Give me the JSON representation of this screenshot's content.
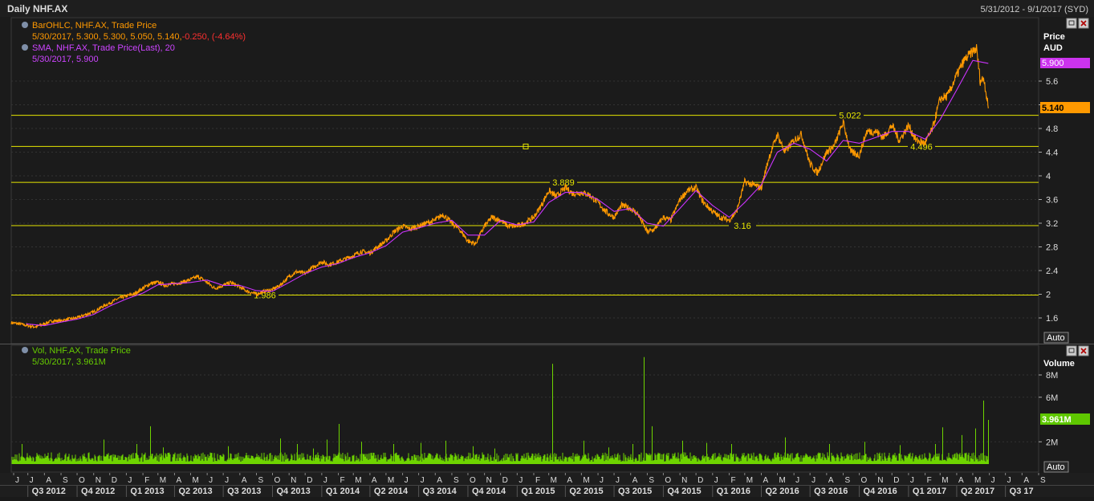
{
  "header": {
    "title": "Daily NHF.AX",
    "range": "5/31/2012 - 9/1/2017 (SYD)"
  },
  "price_panel": {
    "legend": [
      {
        "name": "BarOHLC, NHF.AX, Trade Price",
        "values": "5/30/2017, 5.300, 5.300, 5.050, 5.140,",
        "change": "-0.250, (-4.64%)",
        "color": "#ff9900",
        "change_color": "#ff3030"
      },
      {
        "name": "SMA, NHF.AX, Trade Price(Last),  20",
        "values": "5/30/2017, 5.900",
        "color": "#cc44ff"
      }
    ],
    "axis_title_1": "Price",
    "axis_title_2": "AUD",
    "auto_label": "Auto",
    "badges": {
      "sma": "5.900",
      "last": "5.140"
    }
  },
  "volume_panel": {
    "legend": {
      "name": "Vol, NHF.AX, Trade Price",
      "values": "5/30/2017, 3.961M",
      "color": "#66cc00"
    },
    "axis_title": "Volume",
    "auto_label": "Auto",
    "badge": "3.961M"
  },
  "colors": {
    "price": "#ff9900",
    "sma": "#cc33ff",
    "volume": "#6ed400",
    "hline": "#e6e600",
    "bg": "#1b1b1b",
    "grid": "#333333"
  },
  "chart_data": [
    {
      "type": "line",
      "title": "Daily NHF.AX",
      "x_range": [
        "2012-05-31",
        "2017-09-01"
      ],
      "ylabel": "Price AUD",
      "ylim": [
        1.2,
        6.3
      ],
      "yticks": [
        "1.6",
        "2",
        "2.4",
        "2.8",
        "3.2",
        "3.6",
        "4",
        "4.4",
        "4.8",
        "5.2",
        "5.6"
      ],
      "grid": true,
      "series": [
        {
          "name": "BarOHLC, NHF.AX, Trade Price",
          "points": [
            [
              "2012-05-31",
              1.52
            ],
            [
              "2012-06-15",
              1.5
            ],
            [
              "2012-07-01",
              1.47
            ],
            [
              "2012-07-15",
              1.45
            ],
            [
              "2012-08-01",
              1.5
            ],
            [
              "2012-08-15",
              1.55
            ],
            [
              "2012-09-01",
              1.55
            ],
            [
              "2012-09-15",
              1.58
            ],
            [
              "2012-10-01",
              1.6
            ],
            [
              "2012-10-15",
              1.65
            ],
            [
              "2012-11-01",
              1.7
            ],
            [
              "2012-11-15",
              1.78
            ],
            [
              "2012-12-01",
              1.85
            ],
            [
              "2012-12-15",
              1.92
            ],
            [
              "2013-01-01",
              1.97
            ],
            [
              "2013-01-15",
              2.0
            ],
            [
              "2013-02-01",
              2.1
            ],
            [
              "2013-02-15",
              2.18
            ],
            [
              "2013-03-01",
              2.2
            ],
            [
              "2013-03-15",
              2.15
            ],
            [
              "2013-04-01",
              2.18
            ],
            [
              "2013-04-15",
              2.2
            ],
            [
              "2013-05-01",
              2.25
            ],
            [
              "2013-05-15",
              2.3
            ],
            [
              "2013-06-01",
              2.2
            ],
            [
              "2013-06-15",
              2.1
            ],
            [
              "2013-07-01",
              2.15
            ],
            [
              "2013-07-15",
              2.2
            ],
            [
              "2013-08-01",
              2.12
            ],
            [
              "2013-08-15",
              2.05
            ],
            [
              "2013-09-01",
              2.0
            ],
            [
              "2013-09-15",
              2.05
            ],
            [
              "2013-10-01",
              2.08
            ],
            [
              "2013-10-15",
              2.15
            ],
            [
              "2013-11-01",
              2.3
            ],
            [
              "2013-11-15",
              2.38
            ],
            [
              "2013-12-01",
              2.35
            ],
            [
              "2013-12-15",
              2.45
            ],
            [
              "2014-01-01",
              2.55
            ],
            [
              "2014-01-15",
              2.5
            ],
            [
              "2014-02-01",
              2.55
            ],
            [
              "2014-02-15",
              2.6
            ],
            [
              "2014-03-01",
              2.65
            ],
            [
              "2014-03-15",
              2.72
            ],
            [
              "2014-04-01",
              2.7
            ],
            [
              "2014-04-15",
              2.8
            ],
            [
              "2014-05-01",
              2.9
            ],
            [
              "2014-05-15",
              3.05
            ],
            [
              "2014-06-01",
              3.15
            ],
            [
              "2014-06-15",
              3.1
            ],
            [
              "2014-07-01",
              3.15
            ],
            [
              "2014-07-15",
              3.2
            ],
            [
              "2014-08-01",
              3.25
            ],
            [
              "2014-08-15",
              3.35
            ],
            [
              "2014-09-01",
              3.2
            ],
            [
              "2014-09-15",
              3.1
            ],
            [
              "2014-10-01",
              2.9
            ],
            [
              "2014-10-15",
              2.85
            ],
            [
              "2014-11-01",
              3.15
            ],
            [
              "2014-11-15",
              3.3
            ],
            [
              "2014-12-01",
              3.25
            ],
            [
              "2014-12-15",
              3.15
            ],
            [
              "2015-01-01",
              3.15
            ],
            [
              "2015-01-15",
              3.2
            ],
            [
              "2015-02-01",
              3.3
            ],
            [
              "2015-02-15",
              3.5
            ],
            [
              "2015-03-01",
              3.75
            ],
            [
              "2015-03-15",
              3.65
            ],
            [
              "2015-04-01",
              3.8
            ],
            [
              "2015-04-15",
              3.7
            ],
            [
              "2015-05-01",
              3.72
            ],
            [
              "2015-05-15",
              3.68
            ],
            [
              "2015-06-01",
              3.55
            ],
            [
              "2015-06-15",
              3.4
            ],
            [
              "2015-07-01",
              3.3
            ],
            [
              "2015-07-15",
              3.5
            ],
            [
              "2015-08-01",
              3.45
            ],
            [
              "2015-08-15",
              3.35
            ],
            [
              "2015-09-01",
              3.05
            ],
            [
              "2015-09-15",
              3.1
            ],
            [
              "2015-10-01",
              3.3
            ],
            [
              "2015-10-15",
              3.25
            ],
            [
              "2015-11-01",
              3.6
            ],
            [
              "2015-11-15",
              3.75
            ],
            [
              "2015-12-01",
              3.8
            ],
            [
              "2015-12-15",
              3.55
            ],
            [
              "2016-01-01",
              3.4
            ],
            [
              "2016-01-15",
              3.3
            ],
            [
              "2016-02-01",
              3.25
            ],
            [
              "2016-02-15",
              3.4
            ],
            [
              "2016-03-01",
              3.9
            ],
            [
              "2016-03-15",
              3.85
            ],
            [
              "2016-04-01",
              3.8
            ],
            [
              "2016-04-15",
              4.3
            ],
            [
              "2016-05-01",
              4.7
            ],
            [
              "2016-05-15",
              4.4
            ],
            [
              "2016-06-01",
              4.6
            ],
            [
              "2016-06-15",
              4.7
            ],
            [
              "2016-07-01",
              4.2
            ],
            [
              "2016-07-15",
              4.05
            ],
            [
              "2016-08-01",
              4.4
            ],
            [
              "2016-08-15",
              4.5
            ],
            [
              "2016-09-01",
              4.9
            ],
            [
              "2016-09-15",
              4.4
            ],
            [
              "2016-10-01",
              4.35
            ],
            [
              "2016-10-15",
              4.75
            ],
            [
              "2016-11-01",
              4.75
            ],
            [
              "2016-11-15",
              4.65
            ],
            [
              "2016-12-01",
              4.85
            ],
            [
              "2016-12-15",
              4.6
            ],
            [
              "2017-01-01",
              4.85
            ],
            [
              "2017-01-15",
              4.6
            ],
            [
              "2017-02-01",
              4.55
            ],
            [
              "2017-02-15",
              4.8
            ],
            [
              "2017-03-01",
              5.3
            ],
            [
              "2017-03-15",
              5.35
            ],
            [
              "2017-04-01",
              5.7
            ],
            [
              "2017-04-15",
              5.95
            ],
            [
              "2017-05-01",
              6.1
            ],
            [
              "2017-05-08",
              6.15
            ],
            [
              "2017-05-15",
              5.6
            ],
            [
              "2017-05-22",
              5.65
            ],
            [
              "2017-05-30",
              5.14
            ]
          ]
        },
        {
          "name": "SMA, NHF.AX, Trade Price(Last),  20",
          "points": [
            [
              "2012-06-28",
              1.5
            ],
            [
              "2012-08-01",
              1.47
            ],
            [
              "2012-09-01",
              1.53
            ],
            [
              "2012-10-01",
              1.58
            ],
            [
              "2012-11-01",
              1.66
            ],
            [
              "2012-12-01",
              1.8
            ],
            [
              "2013-01-01",
              1.92
            ],
            [
              "2013-02-01",
              2.02
            ],
            [
              "2013-03-01",
              2.16
            ],
            [
              "2013-04-01",
              2.18
            ],
            [
              "2013-05-01",
              2.2
            ],
            [
              "2013-06-01",
              2.24
            ],
            [
              "2013-07-01",
              2.15
            ],
            [
              "2013-08-01",
              2.15
            ],
            [
              "2013-09-01",
              2.06
            ],
            [
              "2013-10-01",
              2.05
            ],
            [
              "2013-11-01",
              2.2
            ],
            [
              "2013-12-01",
              2.35
            ],
            [
              "2014-01-01",
              2.46
            ],
            [
              "2014-02-01",
              2.52
            ],
            [
              "2014-03-01",
              2.62
            ],
            [
              "2014-04-01",
              2.7
            ],
            [
              "2014-05-01",
              2.82
            ],
            [
              "2014-06-01",
              3.05
            ],
            [
              "2014-07-01",
              3.12
            ],
            [
              "2014-08-01",
              3.2
            ],
            [
              "2014-09-01",
              3.25
            ],
            [
              "2014-10-01",
              3.0
            ],
            [
              "2014-11-01",
              3.0
            ],
            [
              "2014-12-01",
              3.25
            ],
            [
              "2015-01-01",
              3.17
            ],
            [
              "2015-02-01",
              3.22
            ],
            [
              "2015-03-01",
              3.55
            ],
            [
              "2015-04-01",
              3.72
            ],
            [
              "2015-05-01",
              3.72
            ],
            [
              "2015-06-01",
              3.6
            ],
            [
              "2015-07-01",
              3.4
            ],
            [
              "2015-08-01",
              3.45
            ],
            [
              "2015-09-01",
              3.2
            ],
            [
              "2015-10-01",
              3.15
            ],
            [
              "2015-11-01",
              3.45
            ],
            [
              "2015-12-01",
              3.75
            ],
            [
              "2016-01-01",
              3.5
            ],
            [
              "2016-02-01",
              3.3
            ],
            [
              "2016-03-01",
              3.55
            ],
            [
              "2016-04-01",
              3.85
            ],
            [
              "2016-05-01",
              4.4
            ],
            [
              "2016-06-01",
              4.55
            ],
            [
              "2016-07-01",
              4.45
            ],
            [
              "2016-08-01",
              4.25
            ],
            [
              "2016-09-01",
              4.6
            ],
            [
              "2016-10-01",
              4.55
            ],
            [
              "2016-11-01",
              4.65
            ],
            [
              "2016-12-01",
              4.75
            ],
            [
              "2017-01-01",
              4.75
            ],
            [
              "2017-02-01",
              4.62
            ],
            [
              "2017-03-01",
              4.95
            ],
            [
              "2017-04-01",
              5.45
            ],
            [
              "2017-05-01",
              5.95
            ],
            [
              "2017-05-30",
              5.9
            ]
          ]
        }
      ],
      "hlines": [
        {
          "value": 1.986,
          "label": "1.986"
        },
        {
          "value": 3.16,
          "label": "3.16"
        },
        {
          "value": 3.889,
          "label": "3.889"
        },
        {
          "value": 4.496,
          "label": "4.496"
        },
        {
          "value": 5.022,
          "label": "5.022"
        }
      ]
    },
    {
      "type": "bar",
      "title": "Vol, NHF.AX, Trade Price",
      "ylabel": "Volume",
      "ylim": [
        0,
        10000000
      ],
      "yticks": [
        "2M",
        "6M",
        "8M"
      ],
      "baseline_volume": 600000,
      "spikes": [
        [
          "2012-06-20",
          1800000
        ],
        [
          "2012-11-20",
          2200000
        ],
        [
          "2013-01-20",
          1800000
        ],
        [
          "2013-02-15",
          3400000
        ],
        [
          "2013-03-10",
          1500000
        ],
        [
          "2013-07-10",
          1600000
        ],
        [
          "2013-10-15",
          2300000
        ],
        [
          "2013-11-15",
          1800000
        ],
        [
          "2013-12-15",
          1400000
        ],
        [
          "2014-01-10",
          2200000
        ],
        [
          "2014-02-01",
          3600000
        ],
        [
          "2014-03-15",
          2000000
        ],
        [
          "2014-05-15",
          1800000
        ],
        [
          "2014-07-05",
          1900000
        ],
        [
          "2014-08-20",
          2100000
        ],
        [
          "2014-10-10",
          1600000
        ],
        [
          "2014-11-20",
          1400000
        ],
        [
          "2015-03-07",
          9000000
        ],
        [
          "2015-05-05",
          2100000
        ],
        [
          "2015-06-20",
          1500000
        ],
        [
          "2015-08-05",
          1800000
        ],
        [
          "2015-08-25",
          9600000
        ],
        [
          "2015-09-10",
          3400000
        ],
        [
          "2015-11-05",
          2100000
        ],
        [
          "2015-12-20",
          1900000
        ],
        [
          "2016-02-05",
          1800000
        ],
        [
          "2016-05-15",
          2400000
        ],
        [
          "2016-08-05",
          1800000
        ],
        [
          "2016-10-10",
          2000000
        ],
        [
          "2016-12-15",
          1700000
        ],
        [
          "2017-02-20",
          1800000
        ],
        [
          "2017-03-05",
          3300000
        ],
        [
          "2017-04-10",
          2600000
        ],
        [
          "2017-05-05",
          3200000
        ],
        [
          "2017-05-20",
          5700000
        ],
        [
          "2017-05-30",
          3961000
        ]
      ]
    }
  ],
  "xaxis": {
    "months": [
      "J",
      "J",
      "A",
      "S",
      "O",
      "N",
      "D",
      "J",
      "F",
      "M",
      "A",
      "M",
      "J",
      "J",
      "A",
      "S",
      "O",
      "N",
      "D",
      "J",
      "F",
      "M",
      "A",
      "M",
      "J",
      "J",
      "A",
      "S",
      "O",
      "N",
      "D",
      "J",
      "F",
      "M",
      "A",
      "M",
      "J",
      "J",
      "A",
      "S",
      "O",
      "N",
      "D",
      "J",
      "F",
      "M",
      "A",
      "M",
      "J",
      "J",
      "A",
      "S",
      "O",
      "N",
      "D",
      "J",
      "F",
      "M",
      "A",
      "M",
      "J",
      "J",
      "A",
      "S"
    ],
    "quarters": [
      "Q3 2012",
      "Q4 2012",
      "Q1 2013",
      "Q2 2013",
      "Q3 2013",
      "Q4 2013",
      "Q1 2014",
      "Q2 2014",
      "Q3 2014",
      "Q4 2014",
      "Q1 2015",
      "Q2 2015",
      "Q3 2015",
      "Q4 2015",
      "Q1 2016",
      "Q2 2016",
      "Q3 2016",
      "Q4 2016",
      "Q1 2017",
      "Q2 2017",
      "Q3 17"
    ]
  }
}
